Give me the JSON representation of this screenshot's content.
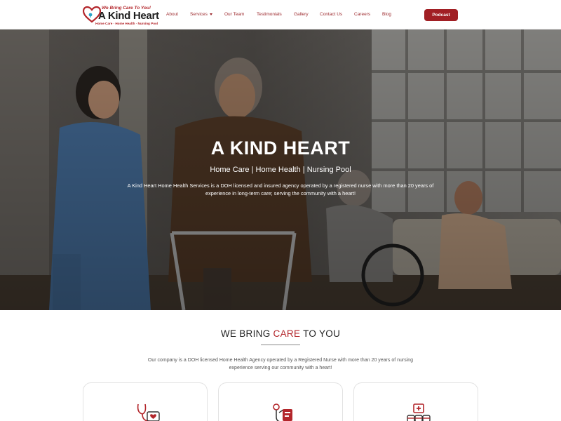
{
  "logo": {
    "tagline": "We Bring Care To You!",
    "name": "A Kind Heart",
    "subtitle": "Home Care · Home Health · Nursing Pool",
    "icon": "heart-stethoscope-icon"
  },
  "nav": {
    "items": [
      {
        "label": "About"
      },
      {
        "label": "Services"
      },
      {
        "label": "Our Team"
      },
      {
        "label": "Testimonials"
      },
      {
        "label": "Gallery"
      },
      {
        "label": "Contact Us"
      },
      {
        "label": "Careers"
      },
      {
        "label": "Blog"
      }
    ],
    "podcast_label": "Podcast"
  },
  "hero": {
    "title": "A KIND HEART",
    "subtitle": "Home Care | Home Health | Nursing Pool",
    "description": "A Kind Heart Home Health Services is a DOH licensed and insured agency operated by a registered nurse with more than 20 years of experience in long-term care; serving the community with a heart!"
  },
  "section": {
    "title_prefix": "WE BRING ",
    "title_accent": "CARE",
    "title_suffix": " TO YOU",
    "description": "Our company is a DOH licensed Home Health Agency operated by a Registered Nurse with more than 20 years of nursing experience serving our community with a heart!"
  },
  "cards": [
    {
      "icon": "stethoscope-heart-icon"
    },
    {
      "icon": "stethoscope-clipboard-icon"
    },
    {
      "icon": "medical-kit-icon"
    }
  ],
  "colors": {
    "brand_red": "#a11f24",
    "nav_text": "#9d2a2e",
    "accent": "#b3262b"
  }
}
